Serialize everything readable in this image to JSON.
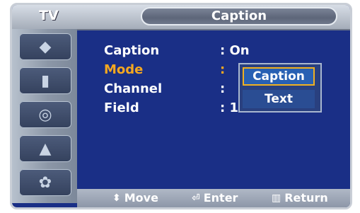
{
  "header": {
    "menu_label": "TV",
    "title": "Caption"
  },
  "sidebar": {
    "icons": [
      {
        "name": "picture-icon",
        "glyph": "◆"
      },
      {
        "name": "sound-icon",
        "glyph": "▮"
      },
      {
        "name": "channel-icon",
        "glyph": "◎"
      },
      {
        "name": "setup-icon",
        "glyph": "▲"
      },
      {
        "name": "input-icon",
        "glyph": "✿"
      }
    ]
  },
  "menu": {
    "rows": [
      {
        "label": "Caption",
        "value": ":  On"
      },
      {
        "label": "Mode",
        "value": ":"
      },
      {
        "label": "Channel",
        "value": ":"
      },
      {
        "label": "Field",
        "value": ":  1"
      }
    ],
    "dropdown": {
      "options": [
        "Caption",
        "Text"
      ],
      "selected": "Caption"
    }
  },
  "footer": {
    "move_label": "Move",
    "move_icon": "⬍",
    "enter_label": "Enter",
    "enter_icon": "⏎",
    "return_label": "Return",
    "return_icon": "▥"
  }
}
